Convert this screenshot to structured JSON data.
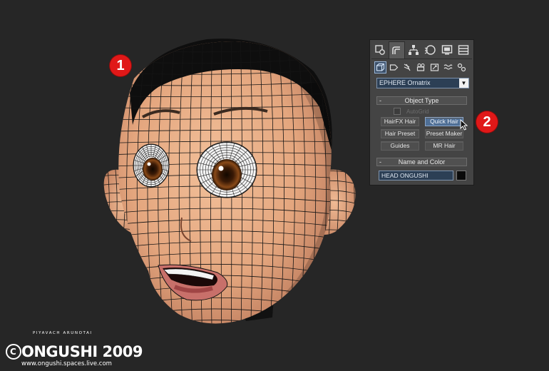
{
  "viewport": {
    "subject": "head-wireframe",
    "markers": [
      {
        "label": "1"
      },
      {
        "label": "2"
      }
    ]
  },
  "command_panel": {
    "top_tabs": [
      {
        "icon": "create-icon",
        "active": false
      },
      {
        "icon": "modify-icon",
        "active": true
      },
      {
        "icon": "hierarchy-icon",
        "active": false
      },
      {
        "icon": "motion-icon",
        "active": false
      },
      {
        "icon": "display-icon",
        "active": false
      },
      {
        "icon": "utilities-icon",
        "active": false
      }
    ],
    "sub_icons": [
      {
        "icon": "geometry-icon",
        "active": true
      },
      {
        "icon": "shapes-icon",
        "active": false
      },
      {
        "icon": "lights-icon",
        "active": false
      },
      {
        "icon": "cameras-icon",
        "active": false
      },
      {
        "icon": "helpers-icon",
        "active": false
      },
      {
        "icon": "spacewarps-icon",
        "active": false
      },
      {
        "icon": "systems-icon",
        "active": false
      }
    ],
    "category_dropdown": {
      "value": "EPHERE Ornatrix"
    },
    "object_type": {
      "header": "Object Type",
      "autogrid_label": "AutoGrid",
      "buttons": {
        "hairfx": "HairFX Hair",
        "quickhair": "Quick Hair",
        "hairpreset": "Hair Preset",
        "presetmaker": "Preset Maker",
        "guides": "Guides",
        "mrhair": "MR Hair"
      },
      "active_button": "Quick Hair"
    },
    "name_and_color": {
      "header": "Name and Color",
      "name_value": "HEAD ONGUSHI",
      "color": "#0a0a0a"
    },
    "rollout_toggle": "-"
  },
  "watermark": {
    "author": "PIYAVACH ARUNOTAI",
    "title": "ONGUSHI 2009",
    "url": "www.ongushi.spaces.live.com"
  },
  "colors": {
    "background": "#262626",
    "panel": "#444444",
    "marker": "#e01818",
    "active_button": "#4f6f96",
    "skin": "#e3a57c",
    "wire": "#111111"
  }
}
